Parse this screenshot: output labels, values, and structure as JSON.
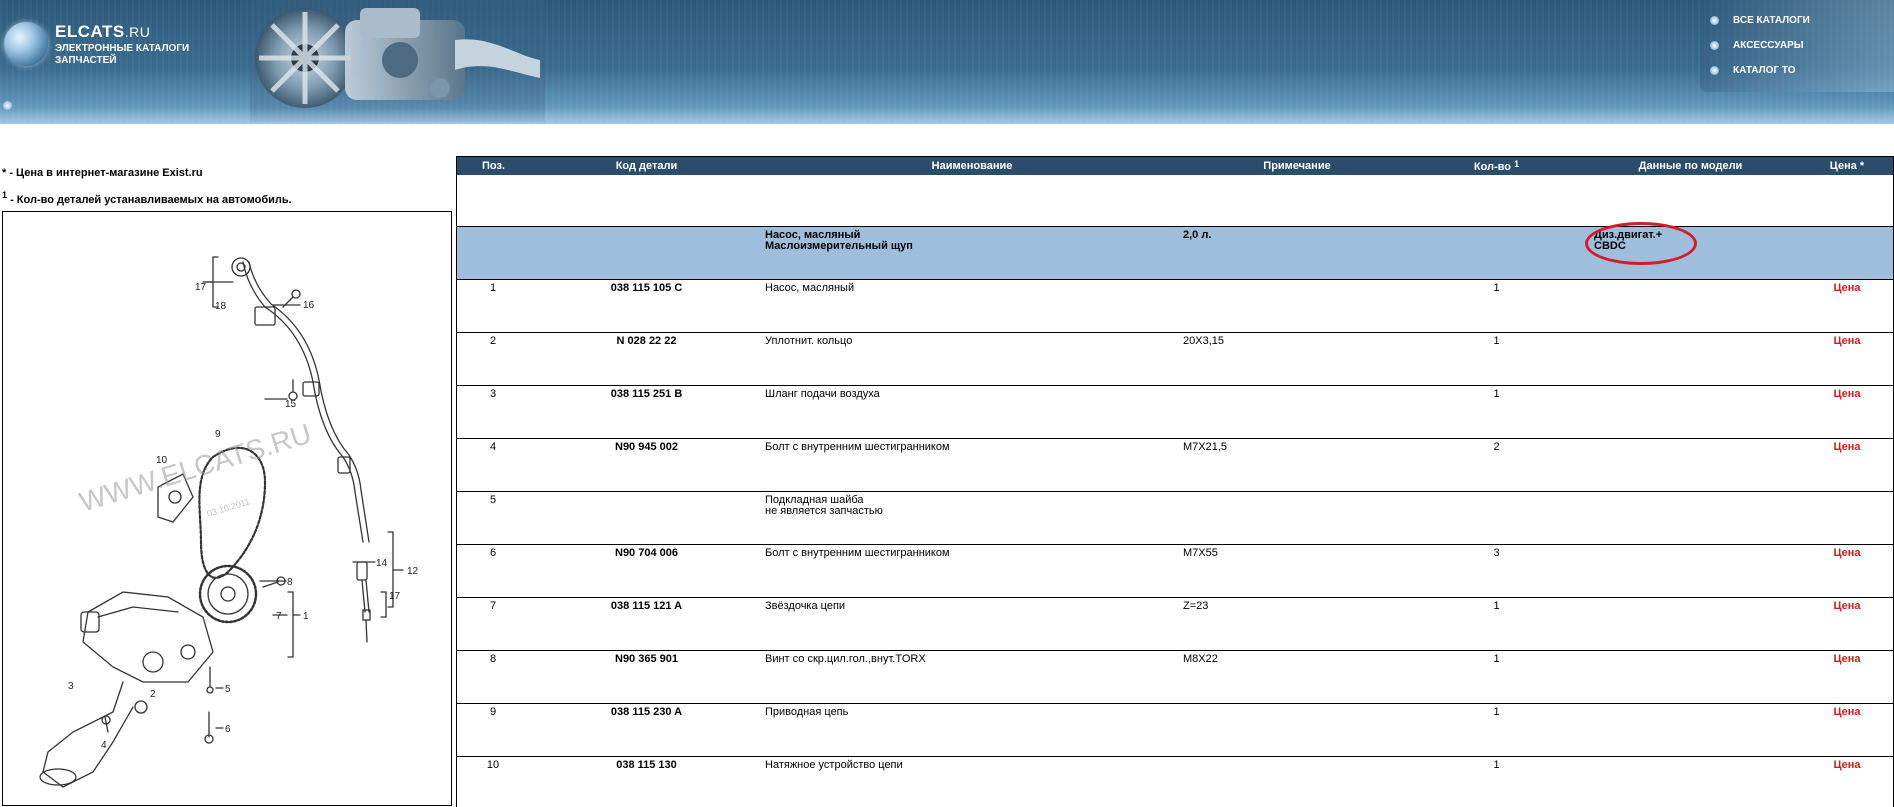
{
  "header": {
    "brand_name": "ELCATS",
    "brand_tld": ".RU",
    "brand_line1": "ЭЛЕКТРОННЫЕ КАТАЛОГИ",
    "brand_line2": "ЗАПЧАСТЕЙ",
    "menu": [
      {
        "label": "ВСЕ КАТАЛОГИ"
      },
      {
        "label": "АКСЕССУАРЫ"
      },
      {
        "label": "КАТАЛОГ ТО"
      }
    ]
  },
  "notes": [
    {
      "marker": "*",
      "text": " - Цена в интернет-магазине Exist.ru"
    },
    {
      "marker": "1",
      "text": " - Кол-во деталей устанавливаемых на автомобиль."
    }
  ],
  "diagram": {
    "watermark": "WWW.ELCATS.RU",
    "watermark_date": "03.10.2011",
    "callouts": [
      "17",
      "18",
      "16",
      "15",
      "9",
      "10",
      "14",
      "12",
      "17",
      "8",
      "7",
      "1",
      "2",
      "3",
      "4",
      "5",
      "6"
    ]
  },
  "table": {
    "headers": {
      "pos": "Поз.",
      "code": "Код детали",
      "name": "Наименование",
      "note": "Примечание",
      "qty": "Кол-во",
      "qty_sup": "1",
      "model": "Данные по модели",
      "price": "Цена *"
    },
    "group": {
      "name_line1": "Насос, масляный",
      "name_line2": "Маслоизмерительный щуп",
      "note": "2,0 л.",
      "model_line1": "Диз.двигат.+",
      "model_line2": "CBDC"
    },
    "price_label": "Цена",
    "rows": [
      {
        "pos": "1",
        "code": "038 115 105 C",
        "name": "Насос, масляный",
        "name2": "",
        "note": "",
        "qty": "1",
        "price": "Цена"
      },
      {
        "pos": "2",
        "code": "N 028 22 22",
        "name": "Уплотнит. кольцо",
        "name2": "",
        "note": "20X3,15",
        "qty": "1",
        "price": "Цена"
      },
      {
        "pos": "3",
        "code": "038 115 251 B",
        "name": "Шланг подачи воздуха",
        "name2": "",
        "note": "",
        "qty": "1",
        "price": "Цена"
      },
      {
        "pos": "4",
        "code": "N90 945 002",
        "name": "Болт с внутренним шестигранником",
        "name2": "",
        "note": "M7X21,5",
        "qty": "2",
        "price": "Цена"
      },
      {
        "pos": "5",
        "code": "",
        "name": "Подкладная шайба",
        "name2": "не является запчастью",
        "note": "",
        "qty": "",
        "price": ""
      },
      {
        "pos": "6",
        "code": "N90 704 006",
        "name": "Болт с внутренним шестигранником",
        "name2": "",
        "note": "M7X55",
        "qty": "3",
        "price": "Цена"
      },
      {
        "pos": "7",
        "code": "038 115 121 A",
        "name": "Звёздочка цепи",
        "name2": "",
        "note": "Z=23",
        "qty": "1",
        "price": "Цена"
      },
      {
        "pos": "8",
        "code": "N90 365 901",
        "name": "Винт со скр.цил.гол.,внут.TORX",
        "name2": "",
        "note": "M8X22",
        "qty": "1",
        "price": "Цена"
      },
      {
        "pos": "9",
        "code": "038 115 230 A",
        "name": "Приводная цепь",
        "name2": "",
        "note": "",
        "qty": "1",
        "price": "Цена"
      },
      {
        "pos": "10",
        "code": "038 115 130",
        "name": "Натяжное устройство цепи",
        "name2": "",
        "note": "",
        "qty": "1",
        "price": "Цена"
      }
    ]
  }
}
